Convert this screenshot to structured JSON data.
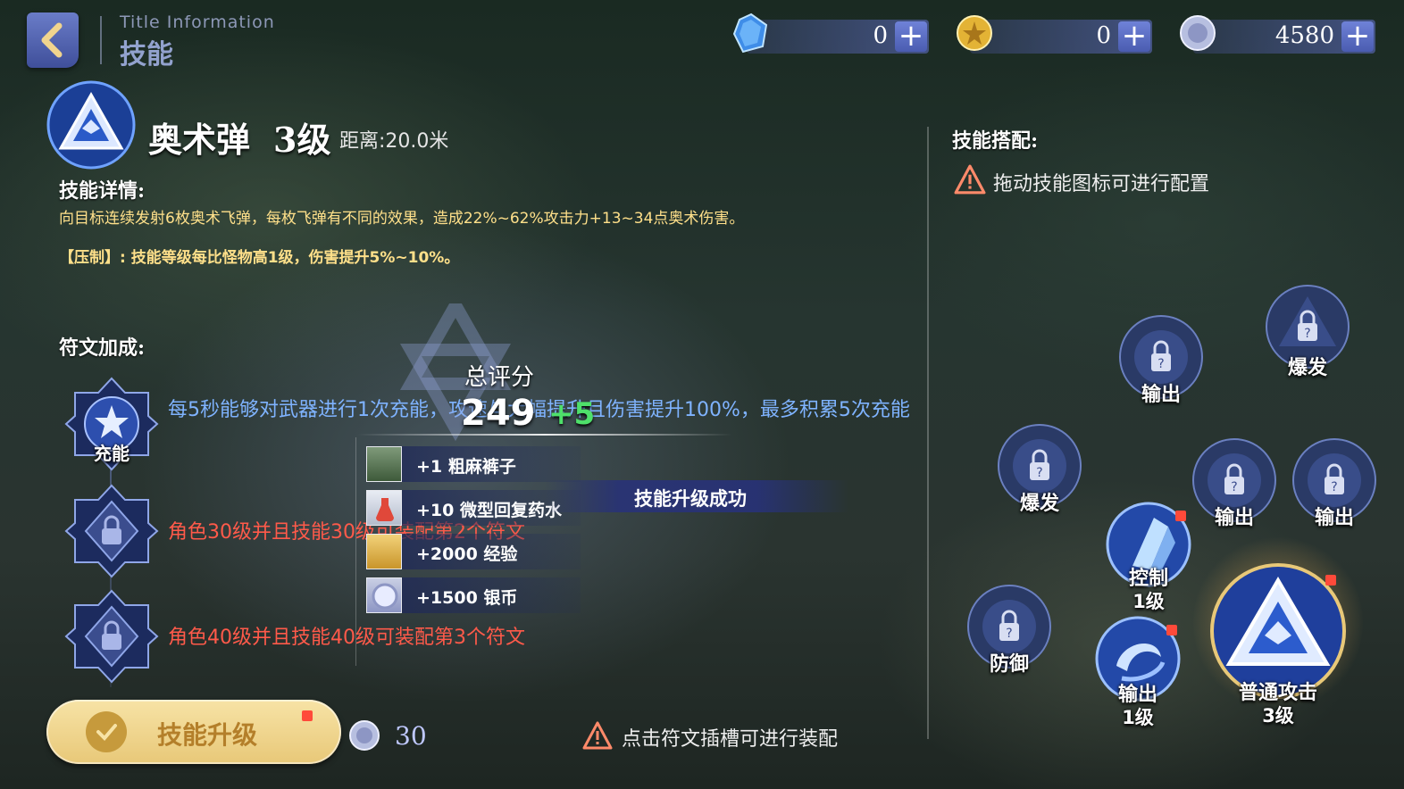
{
  "header": {
    "title_en": "Title  Information",
    "title_cn": "技能"
  },
  "currencies": [
    {
      "name": "crystal",
      "value": "0",
      "icon": "blue-crystal-icon"
    },
    {
      "name": "gold",
      "value": "0",
      "icon": "gold-coin-icon"
    },
    {
      "name": "silver",
      "value": "4580",
      "icon": "silver-coin-icon"
    }
  ],
  "skill": {
    "name": "奥术弹",
    "level": "3级",
    "range": "距离:20.0米",
    "details_heading": "技能详情:",
    "description": "向目标连续发射6枚奥术飞弹，每枚飞弹有不同的效果，造成22%~62%攻击力+13~34点奥术伤害。",
    "suppress": "【压制】: 技能等级每比怪物高1级，伤害提升5%~10%。"
  },
  "runes": {
    "heading": "符文加成:",
    "slots": [
      {
        "label": "充能",
        "text": "每5秒能够对武器进行1次充能，攻速与大幅提升且伤害提升100%，最多积累5次充能",
        "locked": false
      },
      {
        "label": "",
        "text": "角色30级并且技能30级可装配第2个符文",
        "locked": true
      },
      {
        "label": "",
        "text": "角色40级并且技能40级可装配第3个符文",
        "locked": true
      }
    ]
  },
  "score_popup": {
    "label": "总评分",
    "value": "249",
    "delta": "+5",
    "success_text": "技能升级成功",
    "rewards": [
      {
        "text": "+1 粗麻裤子",
        "icon": "pants-icon"
      },
      {
        "text": "+10 微型回复药水",
        "icon": "potion-icon"
      },
      {
        "text": "+2000 经验",
        "icon": "exp-ticket-icon"
      },
      {
        "text": "+1500 银币",
        "icon": "silver-coin-icon"
      }
    ]
  },
  "upgrade": {
    "button_label": "技能升级",
    "cost": "30",
    "hint": "点击符文插槽可进行装配"
  },
  "combo": {
    "heading": "技能搭配:",
    "hint": "拖动技能图标可进行配置",
    "nodes": [
      {
        "label": "爆发",
        "level": "",
        "locked": true
      },
      {
        "label": "输出",
        "level": "",
        "locked": true
      },
      {
        "label": "爆发",
        "level": "",
        "locked": true
      },
      {
        "label": "输出",
        "level": "",
        "locked": true
      },
      {
        "label": "输出",
        "level": "",
        "locked": true
      },
      {
        "label": "控制",
        "level": "1级",
        "locked": false
      },
      {
        "label": "防御",
        "level": "",
        "locked": true
      },
      {
        "label": "输出",
        "level": "1级",
        "locked": false
      },
      {
        "label": "普通攻击",
        "level": "3级",
        "locked": false
      }
    ]
  },
  "colors": {
    "accent_blue": "#5b6fd0",
    "rune_active_text": "#7fb3ff",
    "rune_locked_text": "#ff5a4a",
    "description_text": "#ffe08a",
    "score_delta": "#4ee06a",
    "upgrade_button": "#f0d48e"
  }
}
